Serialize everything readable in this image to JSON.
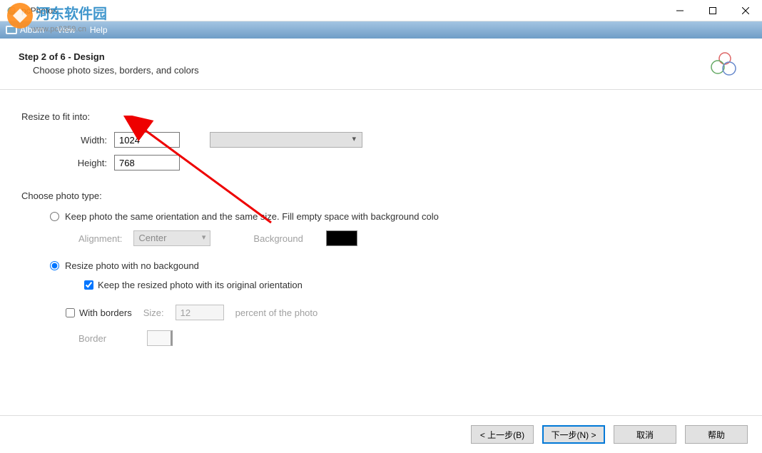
{
  "window": {
    "title": "pcPhotos"
  },
  "menubar": {
    "album": "Album",
    "view": "View",
    "help": "Help"
  },
  "watermark": {
    "text1": "河东软件园",
    "text2": "www.pc0359.cn"
  },
  "wizard": {
    "step_title": "Step 2 of 6 - Design",
    "step_subtitle": "Choose photo sizes, borders, and colors",
    "resize_label": "Resize to fit into:",
    "width_label": "Width:",
    "width_value": "1024",
    "height_label": "Height:",
    "height_value": "768",
    "choose_type": "Choose photo type:",
    "opt_same": "Keep photo the same orientation and the same size. Fill empty space with background colo",
    "alignment_label": "Alignment:",
    "alignment_value": "Center",
    "background_label": "Background",
    "opt_resize": "Resize photo with no backgound",
    "keep_orientation": "Keep the resized photo with its original orientation",
    "with_borders": "With borders",
    "size_label": "Size:",
    "size_value": "12",
    "percent_label": "percent of the photo",
    "border_label": "Border"
  },
  "footer": {
    "back": "< 上一步(B)",
    "next": "下一步(N) >",
    "cancel": "取消",
    "help": "帮助"
  }
}
